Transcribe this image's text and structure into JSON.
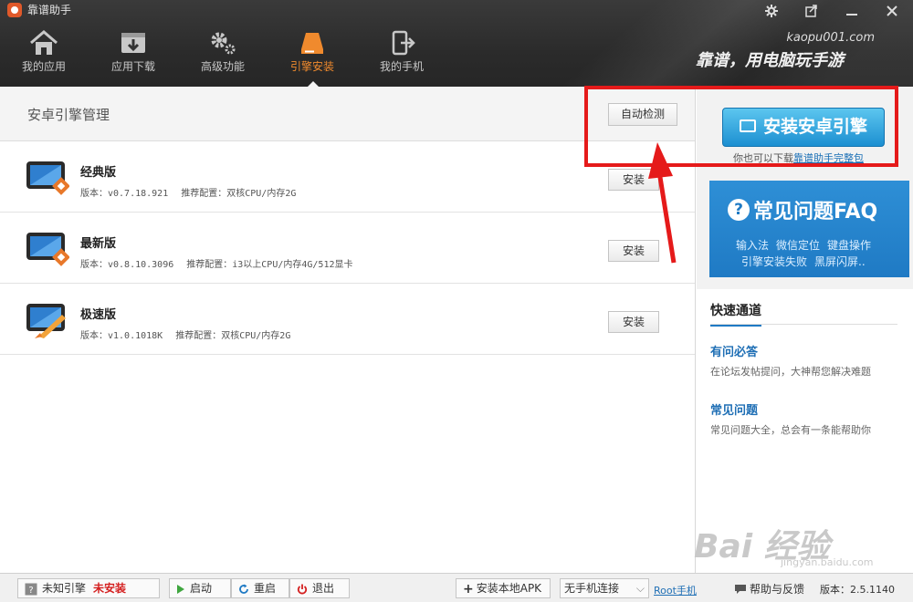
{
  "app": {
    "title": "靠谱助手"
  },
  "window": {
    "settings_icon": "gear-icon",
    "restore_icon": "restore-icon",
    "minimize_icon": "minimize-icon",
    "close_icon": "close-icon"
  },
  "nav": [
    {
      "label": "我的应用",
      "icon": "home-icon",
      "active": false
    },
    {
      "label": "应用下载",
      "icon": "download-icon",
      "active": false
    },
    {
      "label": "高级功能",
      "icon": "gears-icon",
      "active": false
    },
    {
      "label": "引擎安装",
      "icon": "engine-install-icon",
      "active": true
    },
    {
      "label": "我的手机",
      "icon": "phone-connect-icon",
      "active": false
    }
  ],
  "brand": {
    "url": "kaopu001.com",
    "slogan": "靠谱，用电脑玩手游"
  },
  "main": {
    "title": "安卓引擎管理",
    "auto_detect_label": "自动检测",
    "engines": [
      {
        "name": "经典版",
        "version": "版本：v0.7.18.921",
        "config": "推荐配置：双核CPU/内存2G",
        "install_label": "安装",
        "icon": "monitor-orange-badge-icon"
      },
      {
        "name": "最新版",
        "version": "版本：v0.8.10.3096",
        "config": "推荐配置：i3以上CPU/内存4G/512显卡",
        "install_label": "安装",
        "icon": "monitor-orange-badge-icon"
      },
      {
        "name": "极速版",
        "version": "版本：v1.0.1018K",
        "config": "推荐配置：双核CPU/内存2G",
        "install_label": "安装",
        "icon": "monitor-rocket-icon"
      }
    ]
  },
  "side": {
    "install_button_label": "安装安卓引擎",
    "download_tip": "你也可以下载",
    "download_link": "靠谱助手完整包",
    "faq": {
      "title": "常见问题FAQ",
      "line1": [
        "输入法",
        "微信定位",
        "键盘操作"
      ],
      "line2": [
        "引擎安装失败",
        "黑屏闪屏.."
      ]
    },
    "quick": {
      "title": "快速通道",
      "items": [
        {
          "link": "有问必答",
          "desc": "在论坛发帖提问，大神帮您解决难题"
        },
        {
          "link": "常见问题",
          "desc": "常见问题大全，总会有一条能帮助你"
        }
      ]
    }
  },
  "annotation": {
    "highlight_color": "#e51a1a"
  },
  "watermark": {
    "logo": "Bai 经验",
    "url": "jingyan.baidu.com"
  },
  "statusbar": {
    "engine_label": "未知引擎",
    "engine_status": "未安装",
    "start_label": "启动",
    "restart_label": "重启",
    "exit_label": "退出",
    "install_apk_label": "安装本地APK",
    "phone_status": "无手机连接",
    "root_label": "Root手机",
    "help_label": "帮助与反馈",
    "version": "版本：2.5.1140"
  },
  "colors": {
    "accent_orange": "#f08a2d",
    "accent_blue": "#1f7ac4",
    "danger_red": "#e51a1a"
  }
}
